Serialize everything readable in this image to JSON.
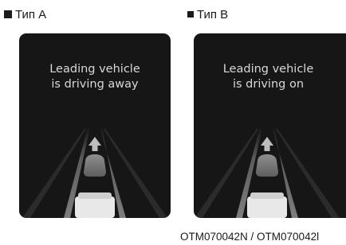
{
  "labels": {
    "type_a": "Тип A",
    "type_b": "Тип B"
  },
  "panels": {
    "a": {
      "message": "Leading vehicle\nis driving away"
    },
    "b": {
      "message": "Leading vehicle\nis driving on"
    }
  },
  "caption": "OTM070042N / OTM070042l",
  "colors": {
    "panel_bg": "#161616",
    "message_text": "#d8d8d8",
    "lane_line": "#8a8a8a",
    "lead_vehicle": "#7a7a7a",
    "ego_vehicle": "#e8e8e8"
  },
  "icons": [
    "square-bullet-icon",
    "arrow-up-icon",
    "lead-vehicle-icon",
    "ego-vehicle-icon",
    "road-lanes-icon"
  ]
}
